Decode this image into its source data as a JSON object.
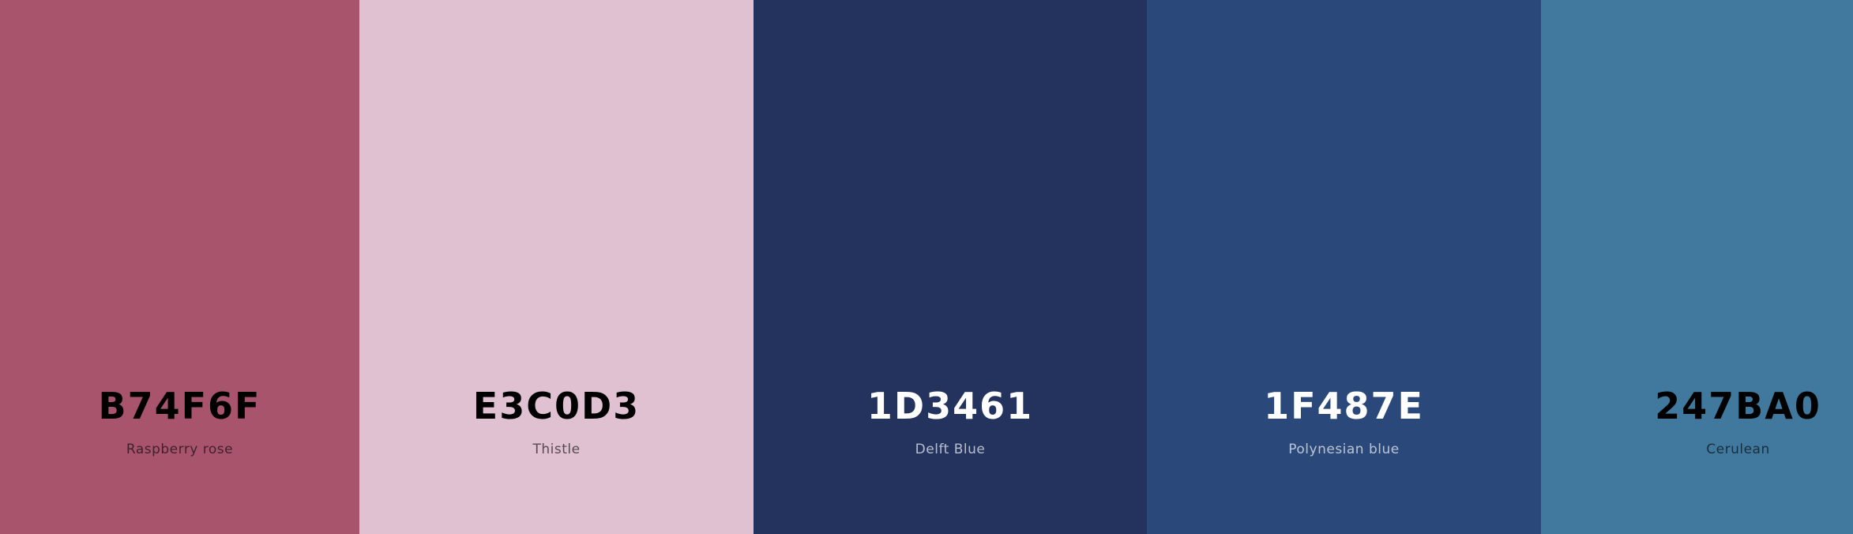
{
  "palette": {
    "colors": [
      {
        "hex": "B74F6F",
        "name": "Raspberry rose",
        "color": "#A8546C",
        "text_tone": "dark"
      },
      {
        "hex": "E3C0D3",
        "name": "Thistle",
        "color": "#E0C1D2",
        "text_tone": "dark"
      },
      {
        "hex": "1D3461",
        "name": "Delft Blue",
        "color": "#23335E",
        "text_tone": "light"
      },
      {
        "hex": "1F487E",
        "name": "Polynesian blue",
        "color": "#2A497A",
        "text_tone": "light"
      },
      {
        "hex": "247BA0",
        "name": "Cerulean",
        "color": "#41799E",
        "text_tone": "dark"
      }
    ]
  }
}
